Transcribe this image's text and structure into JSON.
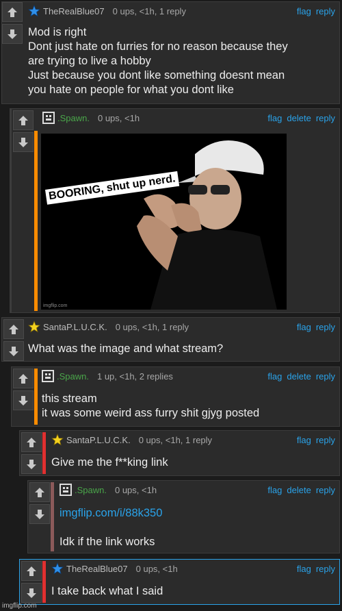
{
  "actions": {
    "flag": "flag",
    "delete": "delete",
    "reply": "reply"
  },
  "comments": [
    {
      "username": "TheRealBlue07",
      "stats": "0 ups, <1h, 1 reply",
      "lines": [
        "Mod is right",
        "Dont just hate on furries for no reason because they",
        "are trying to live a hobby",
        "Just because you dont like something doesnt mean",
        "you hate on people for what you dont like"
      ]
    },
    {
      "username": ".Spawn.",
      "stats": "0 ups, <1h"
    },
    {
      "username": "SantaP.L.U.C.K.",
      "stats": "0 ups, <1h, 1 reply",
      "lines": [
        "What was the image and what stream?"
      ]
    },
    {
      "username": ".Spawn.",
      "stats": "1 up, <1h, 2 replies",
      "lines": [
        "this stream",
        "it was some weird ass furry shit gjyg posted"
      ]
    },
    {
      "username": "SantaP.L.U.C.K.",
      "stats": "0 ups, <1h, 1 reply",
      "lines": [
        "Give me the f**king link"
      ]
    },
    {
      "username": ".Spawn.",
      "stats": "0 ups, <1h",
      "link": "imgflip.com/i/88k350",
      "lines": [
        "Idk if the link works"
      ]
    },
    {
      "username": "TheRealBlue07",
      "stats": "0 ups, <1h",
      "lines": [
        "I take back what I said"
      ]
    }
  ],
  "meme": {
    "caption": "BOORING,  shut up nerd.",
    "watermark": "imgflip.com"
  },
  "footer": "imgflip.com",
  "colors": {
    "accent_link": "#2aa3ea",
    "mod_name": "#4aa64a",
    "orange_bar": "#ff8c00",
    "red_bar": "#e03030",
    "brown_bar": "#8b5a5a"
  }
}
